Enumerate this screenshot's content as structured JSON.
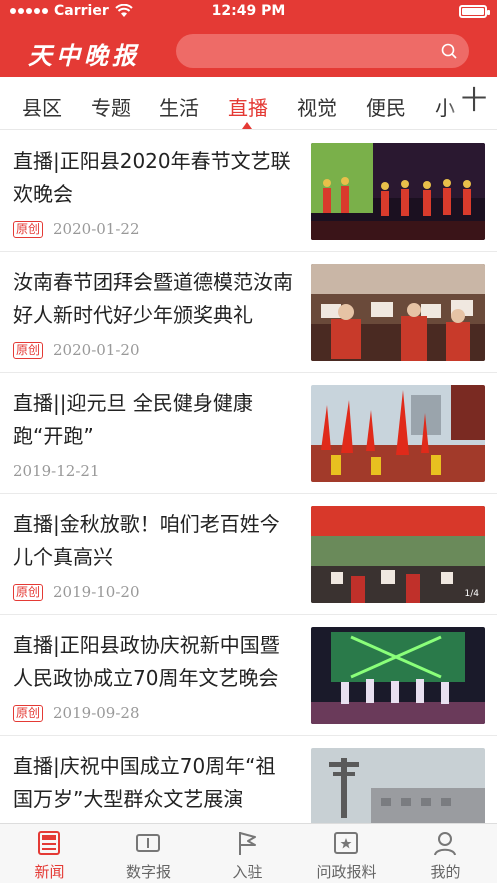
{
  "status_bar": {
    "carrier": "Carrier",
    "time": "12:49 PM"
  },
  "header": {
    "logo": "天中晚报",
    "search_placeholder": ""
  },
  "tabs": [
    {
      "label": "县区"
    },
    {
      "label": "专题"
    },
    {
      "label": "生活"
    },
    {
      "label": "直播",
      "active": true
    },
    {
      "label": "视觉"
    },
    {
      "label": "便民"
    },
    {
      "label": "小"
    }
  ],
  "tab_more": "十",
  "news": [
    {
      "title": "直播|正阳县2020年春节文艺联欢晚会",
      "badge": "原创",
      "date": "2020-01-22"
    },
    {
      "title": "汝南春节团拜会暨道德模范汝南好人新时代好少年颁奖典礼",
      "badge": "原创",
      "date": "2020-01-20"
    },
    {
      "title": "直播||迎元旦 全民健身健康跑“开跑”",
      "badge": "",
      "date": "2019-12-21"
    },
    {
      "title": "直播|金秋放歌！咱们老百姓今儿个真高兴",
      "badge": "原创",
      "date": "2019-10-20",
      "image_counter": "1/4"
    },
    {
      "title": "直播|正阳县政协庆祝新中国暨人民政协成立70周年文艺晚会",
      "badge": "原创",
      "date": "2019-09-28"
    },
    {
      "title": "直播|庆祝中国成立70周年“祖国万岁”大型群众文艺展演",
      "badge": "",
      "date": ""
    }
  ],
  "tabbar": [
    {
      "label": "新闻",
      "icon": "news-icon",
      "active": true
    },
    {
      "label": "数字报",
      "icon": "newspaper-icon"
    },
    {
      "label": "入驻",
      "icon": "flag-icon"
    },
    {
      "label": "问政报料",
      "icon": "report-icon"
    },
    {
      "label": "我的",
      "icon": "user-icon"
    }
  ],
  "colors": {
    "brand": "#e43a35",
    "text": "#222222",
    "muted": "#999999"
  }
}
